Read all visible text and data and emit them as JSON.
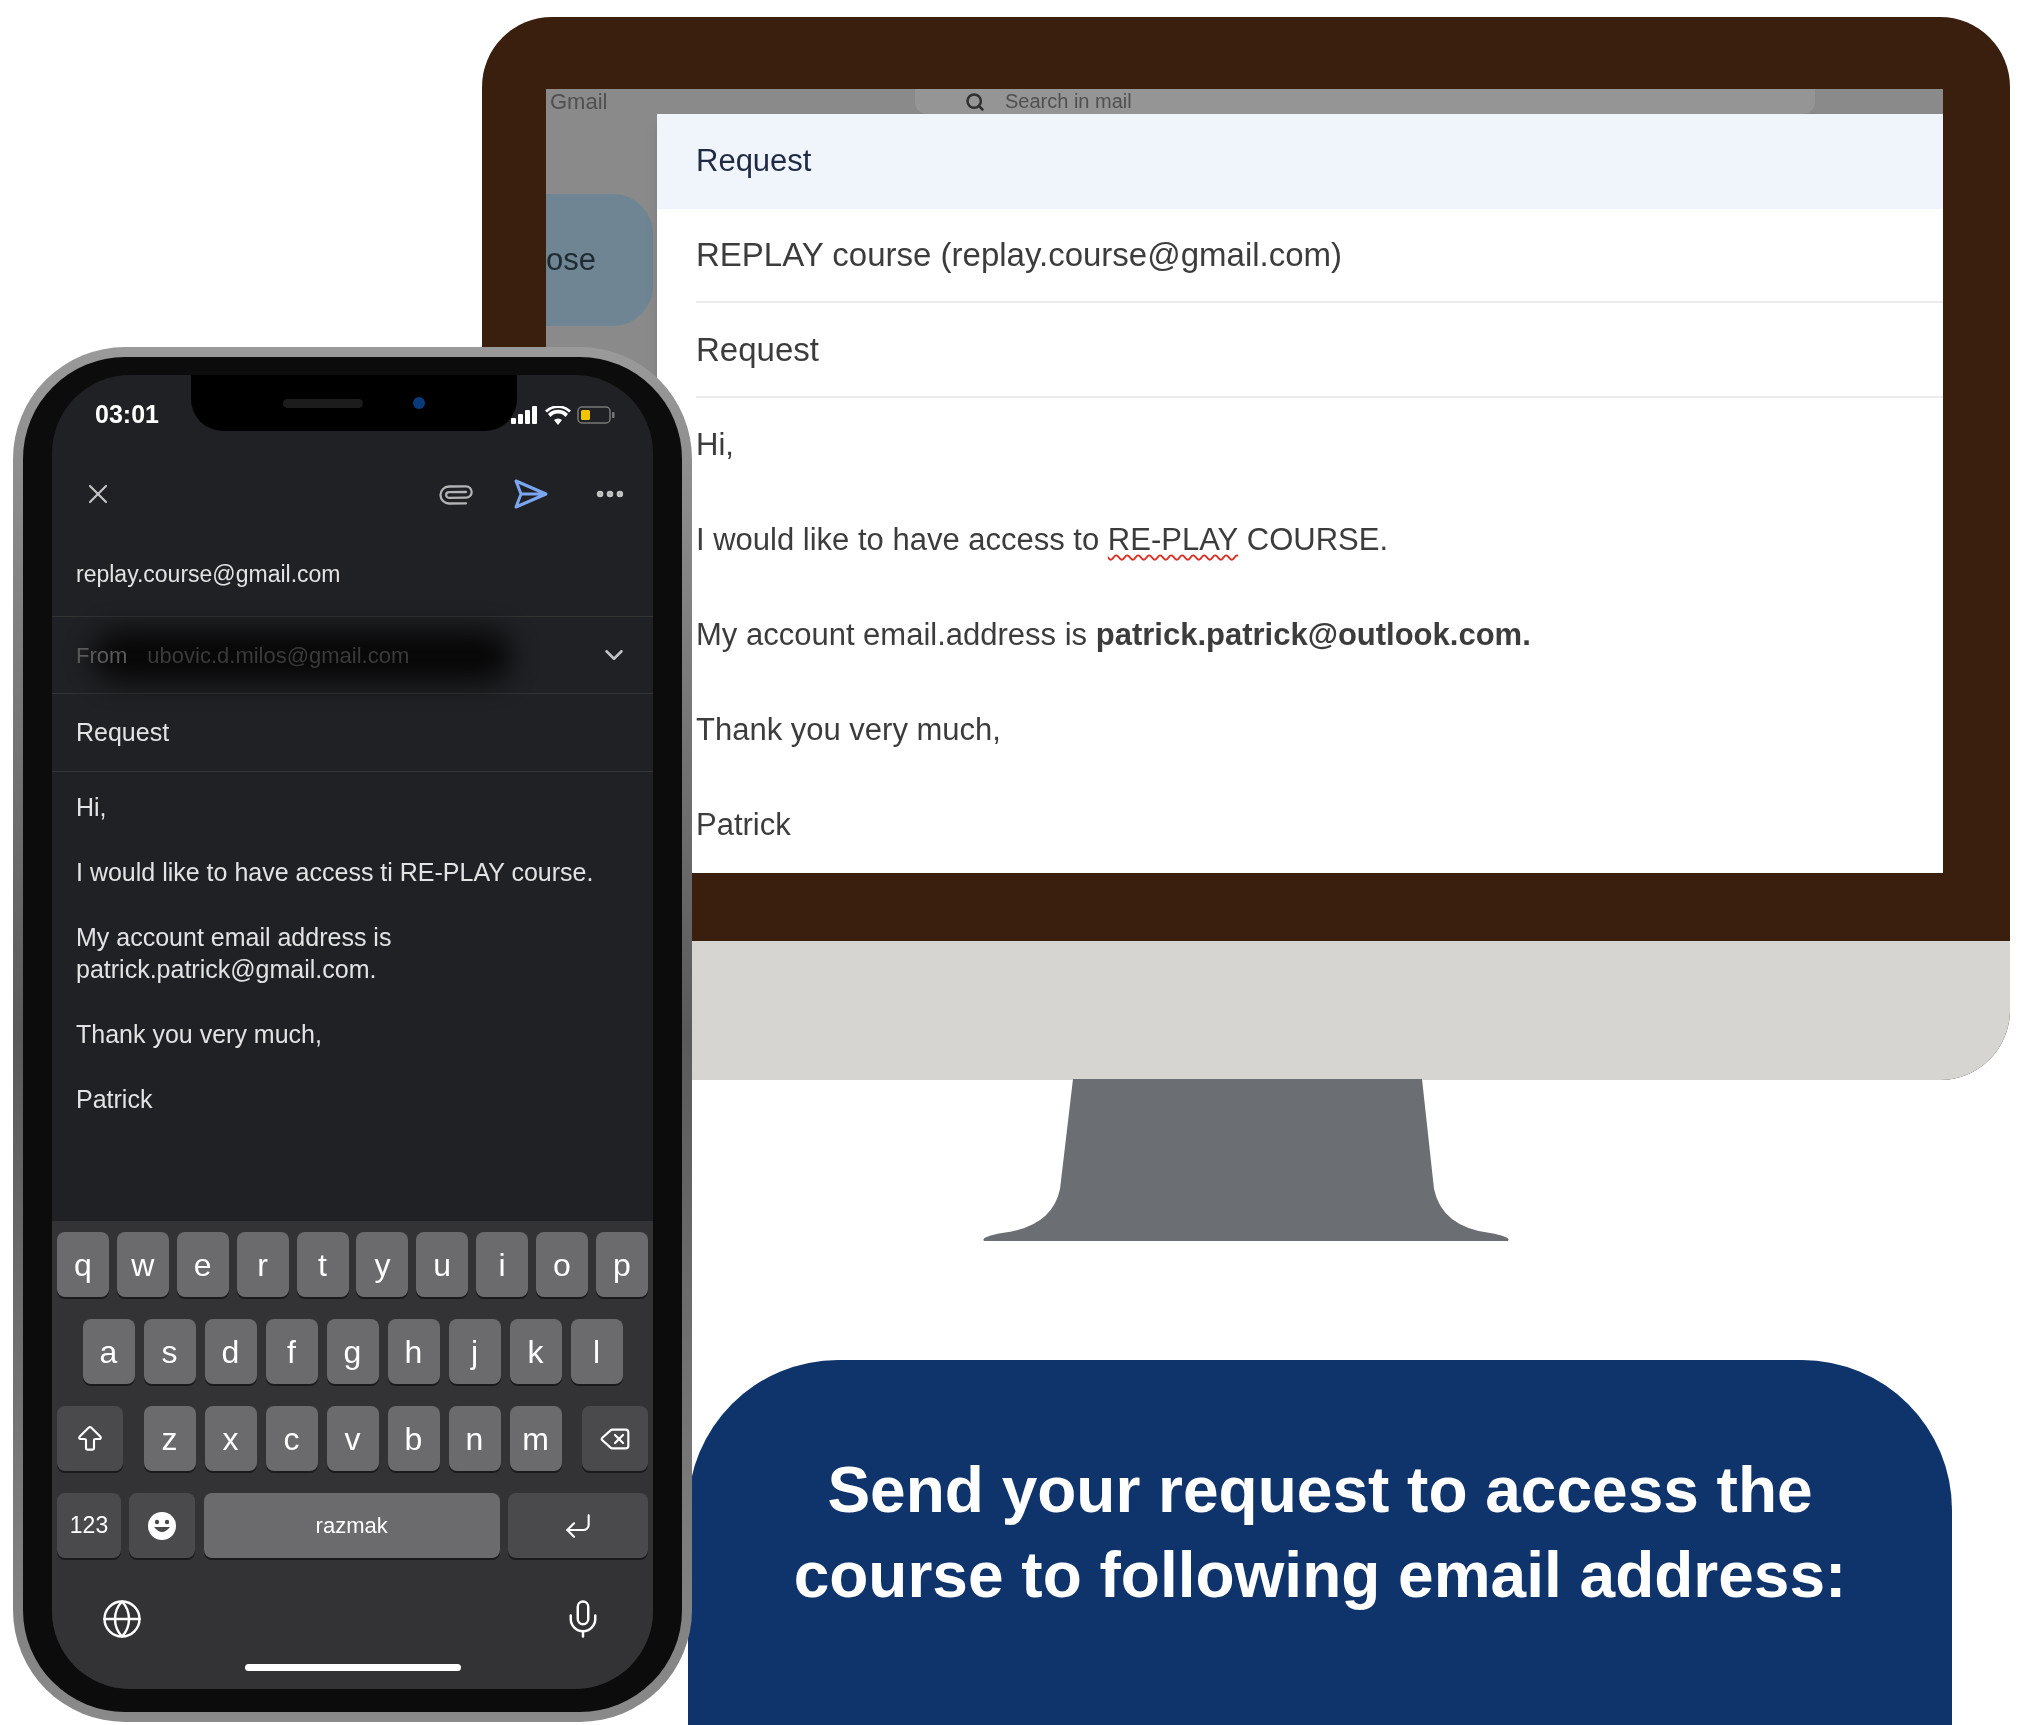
{
  "monitor": {
    "gmail_background": {
      "logo": "Gmail",
      "search_placeholder": "Search in mail",
      "compose_button": "ose"
    },
    "compose": {
      "title": "Request",
      "to": "REPLAY course (replay.course@gmail.com)",
      "subject": "Request",
      "body": [
        [
          {
            "text": "Hi,",
            "misspelled": false
          }
        ],
        [
          {
            "text": "I would like to have access to ",
            "misspelled": false
          },
          {
            "text": "RE-PLAY",
            "misspelled": true
          },
          {
            "text": " COURSE.",
            "misspelled": false
          }
        ],
        [
          {
            "text": "My account email.address is **patrick.patrick@outlook.com.**",
            "misspelled": false
          }
        ],
        [
          {
            "text": "Thank you very much,",
            "misspelled": false
          }
        ],
        [
          {
            "text": "Patrick",
            "misspelled": false
          }
        ]
      ]
    }
  },
  "phone": {
    "status_bar": {
      "time": "03:01"
    },
    "compose": {
      "to": "replay.course@gmail.com",
      "from_label": "From",
      "from": "ubovic.d.milos@gmail.com",
      "subject": "Request",
      "body": [
        "Hi,",
        "I would like to have access ti RE-PLAY course.",
        "My account email address is patrick.patrick@gmail.com.",
        "Thank you very much,",
        "Patrick"
      ]
    },
    "keyboard": {
      "letter_rows": [
        [
          "q",
          "w",
          "e",
          "r",
          "t",
          "y",
          "u",
          "i",
          "o",
          "p"
        ],
        [
          "a",
          "s",
          "d",
          "f",
          "g",
          "h",
          "j",
          "k",
          "l"
        ],
        [
          "z",
          "x",
          "c",
          "v",
          "b",
          "n",
          "m"
        ]
      ],
      "number_key": "123",
      "space_key": "razmak"
    }
  },
  "banner": {
    "title_lines": [
      "Send your request to access the",
      "course to following email address:"
    ]
  }
}
